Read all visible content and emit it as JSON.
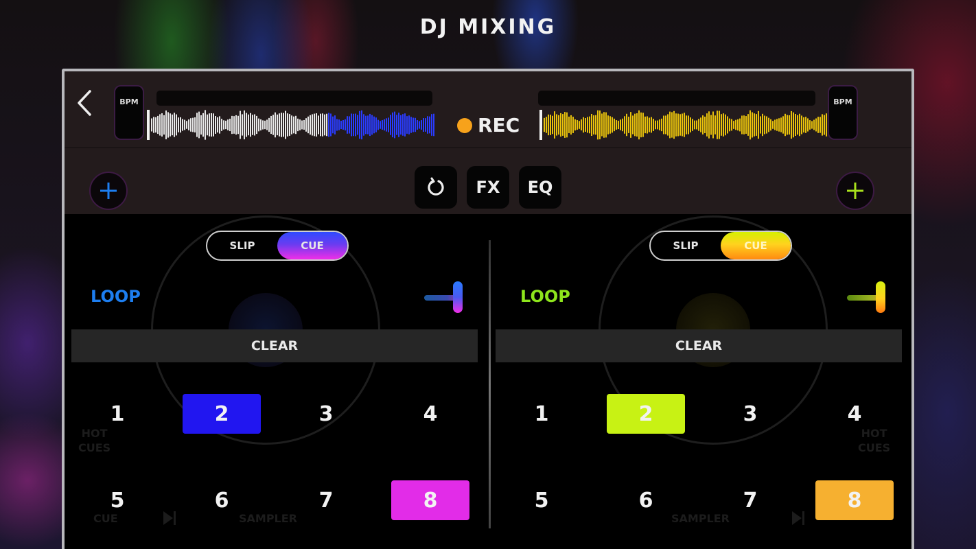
{
  "title": "DJ MIXING",
  "header": {
    "back_icon": "chevron-left-icon",
    "rec_label": "REC",
    "rec_color": "#f7a21b",
    "controls": [
      {
        "id": "reset",
        "icon": "refresh-icon",
        "label": ""
      },
      {
        "id": "fx",
        "label": "FX"
      },
      {
        "id": "eq",
        "label": "EQ"
      }
    ]
  },
  "deck_left": {
    "bpm_label": "BPM",
    "accent": "#1d7ef0",
    "waveform_color_played": "#e8e8e8",
    "waveform_color_remaining": "#2a3cff",
    "add_icon": "plus-icon",
    "toggle": {
      "options": [
        "SLIP",
        "CUE"
      ],
      "selected": "CUE"
    },
    "loop_label": "LOOP",
    "clear_label": "CLEAR",
    "pads": [
      {
        "label": "1",
        "active": false
      },
      {
        "label": "2",
        "active": true,
        "color": "#2116f0"
      },
      {
        "label": "3",
        "active": false
      },
      {
        "label": "4",
        "active": false
      },
      {
        "label": "5",
        "active": false
      },
      {
        "label": "6",
        "active": false
      },
      {
        "label": "7",
        "active": false
      },
      {
        "label": "8",
        "active": true,
        "color": "#e22ce8"
      }
    ],
    "background_labels": {
      "hot_cues": "HOT\nCUES",
      "cue": "CUE",
      "sampler": "SAMPLER"
    }
  },
  "deck_right": {
    "bpm_label": "BPM",
    "accent": "#8ee51c",
    "waveform_color": "#e8c20c",
    "add_icon": "plus-icon",
    "toggle": {
      "options": [
        "SLIP",
        "CUE"
      ],
      "selected": "CUE"
    },
    "loop_label": "LOOP",
    "clear_label": "CLEAR",
    "pads": [
      {
        "label": "1",
        "active": false
      },
      {
        "label": "2",
        "active": true,
        "color": "#c8f214"
      },
      {
        "label": "3",
        "active": false
      },
      {
        "label": "4",
        "active": false
      },
      {
        "label": "5",
        "active": false
      },
      {
        "label": "6",
        "active": false
      },
      {
        "label": "7",
        "active": false
      },
      {
        "label": "8",
        "active": true,
        "color": "#f6b030"
      }
    ],
    "background_labels": {
      "hot_cues": "HOT\nCUES",
      "sampler": "SAMPLER"
    }
  }
}
